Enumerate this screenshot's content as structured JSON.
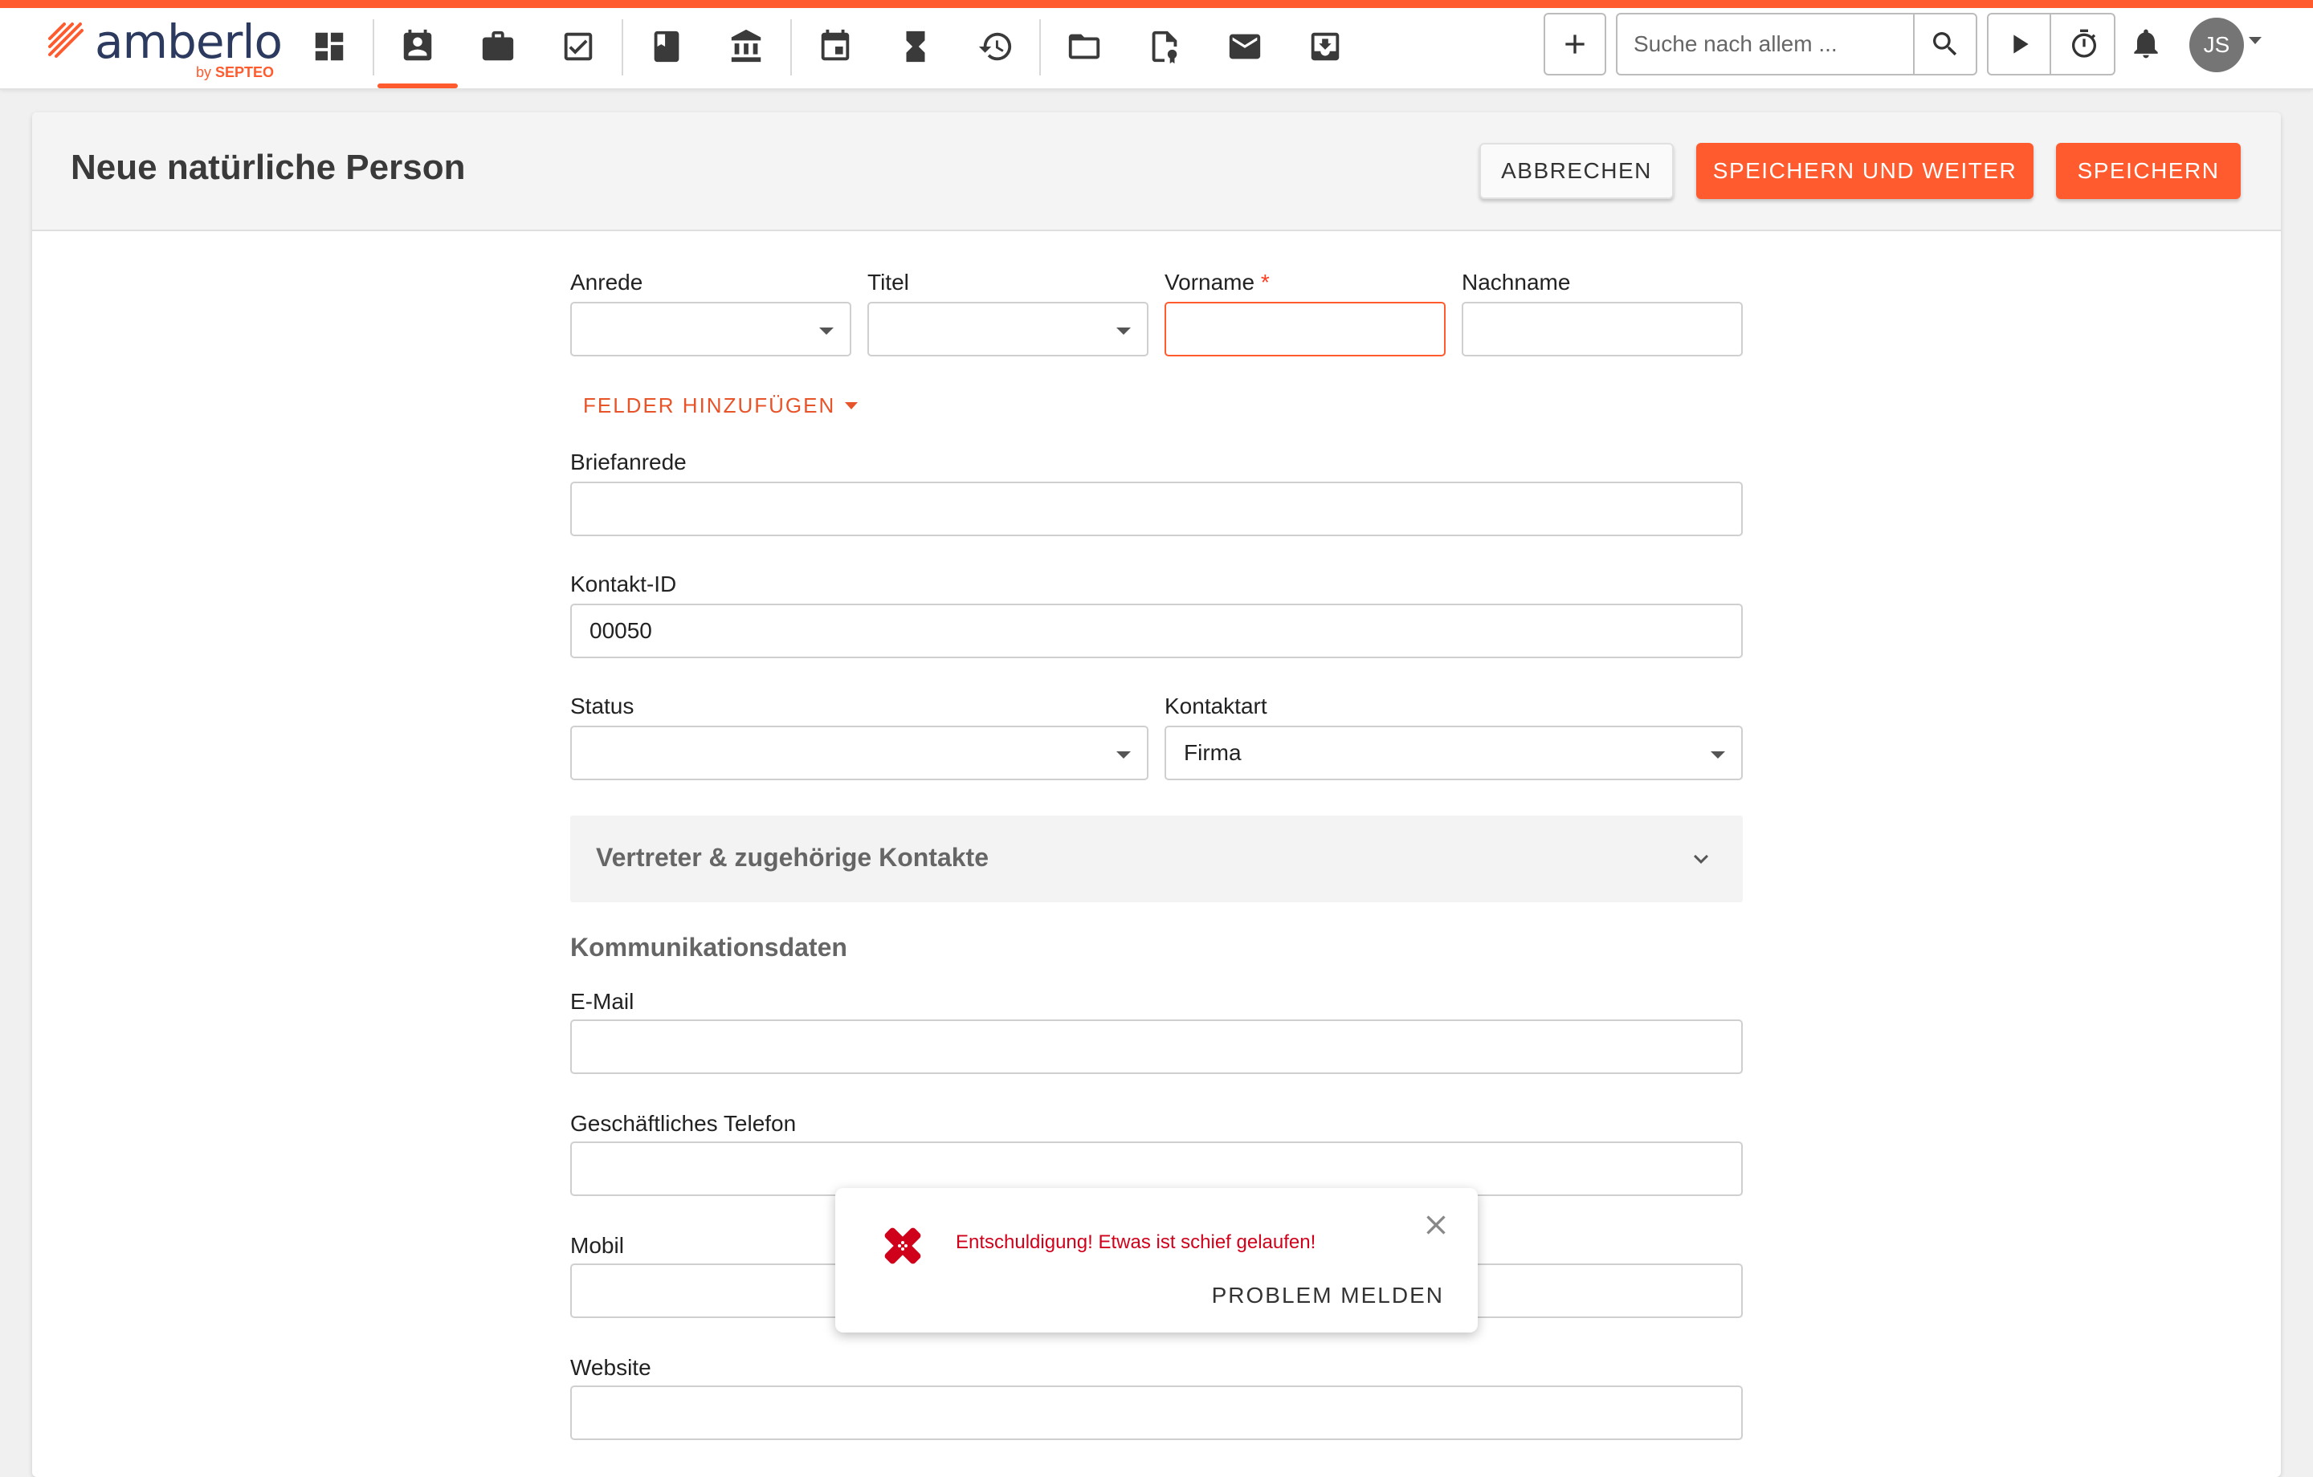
{
  "app": {
    "name": "amberlo",
    "by": "by",
    "brand": "SEPTEO",
    "accent_color": "#ff5b2e"
  },
  "nav": {
    "items": [
      {
        "name": "dashboard-icon"
      },
      {
        "name": "contacts-icon",
        "active": true
      },
      {
        "name": "matters-briefcase-icon"
      },
      {
        "name": "tasks-icon"
      },
      {
        "name": "notebook-icon"
      },
      {
        "name": "bank-icon"
      },
      {
        "name": "calendar-icon"
      },
      {
        "name": "hourglass-icon"
      },
      {
        "name": "billing-history-icon"
      },
      {
        "name": "folder-icon"
      },
      {
        "name": "document-stamp-icon"
      },
      {
        "name": "mail-icon"
      },
      {
        "name": "inbox-download-icon"
      }
    ]
  },
  "search": {
    "placeholder": "Suche nach allem ..."
  },
  "user": {
    "initials": "JS"
  },
  "page": {
    "title": "Neue natürliche Person",
    "buttons": {
      "cancel": "ABBRECHEN",
      "save_next": "SPEICHERN UND WEITER",
      "save": "SPEICHERN"
    }
  },
  "form": {
    "anrede": {
      "label": "Anrede",
      "value": ""
    },
    "titel": {
      "label": "Titel",
      "value": ""
    },
    "vorname": {
      "label": "Vorname",
      "required_marker": "*",
      "value": ""
    },
    "nachname": {
      "label": "Nachname",
      "value": ""
    },
    "add_fields": "FELDER HINZUFÜGEN",
    "briefanrede": {
      "label": "Briefanrede",
      "value": ""
    },
    "kontakt_id": {
      "label": "Kontakt-ID",
      "value": "00050"
    },
    "status": {
      "label": "Status",
      "value": ""
    },
    "kontaktart": {
      "label": "Kontaktart",
      "value": "Firma"
    },
    "accordion": "Vertreter & zugehörige Kontakte",
    "communication_title": "Kommunikationsdaten",
    "email": {
      "label": "E-Mail",
      "value": ""
    },
    "business_phone": {
      "label": "Geschäftliches Telefon",
      "value": ""
    },
    "mobile": {
      "label": "Mobil",
      "value": ""
    },
    "website": {
      "label": "Website",
      "value": ""
    }
  },
  "toast": {
    "message": "Entschuldigung! Etwas ist schief gelaufen!",
    "action": "PROBLEM MELDEN",
    "message_color": "#d0021b"
  }
}
